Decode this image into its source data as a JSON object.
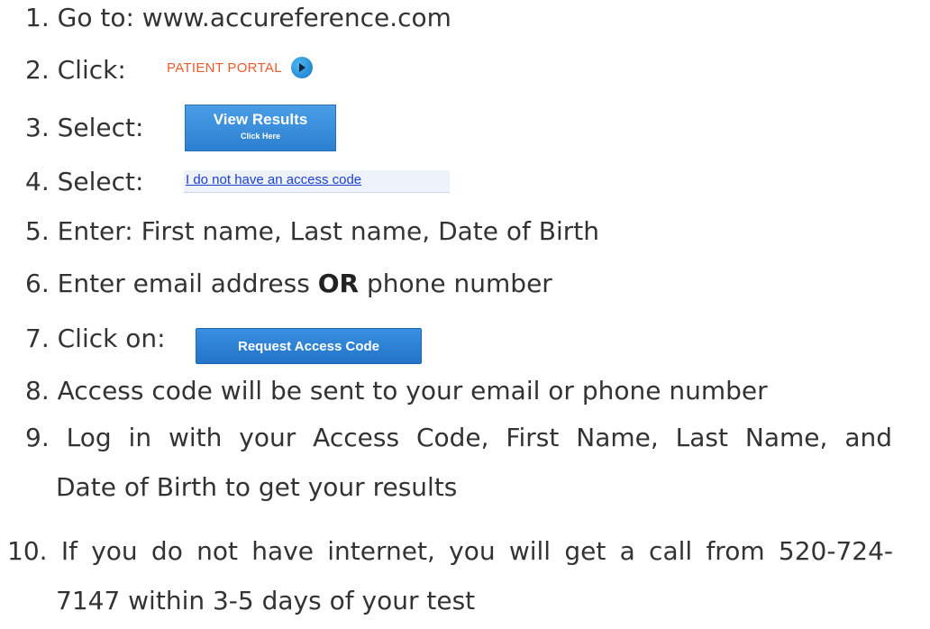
{
  "steps": [
    {
      "num": "1.",
      "text": "Go to: www.accureference.com"
    },
    {
      "num": "2.",
      "text": "Click:"
    },
    {
      "num": "3.",
      "text": "Select:"
    },
    {
      "num": "4.",
      "text": "Select:"
    },
    {
      "num": "5.",
      "text": "Enter: First name, Last name, Date of Birth"
    },
    {
      "num": "6.",
      "pre": "Enter email address",
      "bold": "OR",
      "post": "phone number"
    },
    {
      "num": "7.",
      "text": "Click on:"
    },
    {
      "num": "8.",
      "text": "Access code will be sent to your email or phone number"
    },
    {
      "num": "9.",
      "line1": "Log in with your Access Code, First Name, Last Name, and",
      "line2": "Date of Birth to get your results"
    },
    {
      "num": "10.",
      "line1": "If you do not have internet, you will get a call from 520-724-",
      "line2": "7147 within 3-5 days of your test"
    }
  ],
  "patient_portal": {
    "label": "PATIENT PORTAL",
    "icon": "play-circle-icon",
    "color": "#ef5b2b"
  },
  "view_results": {
    "label": "View Results",
    "sub": "Click Here"
  },
  "access_link": {
    "label": "I do not have an access code"
  },
  "request_button": {
    "label": "Request Access Code"
  }
}
